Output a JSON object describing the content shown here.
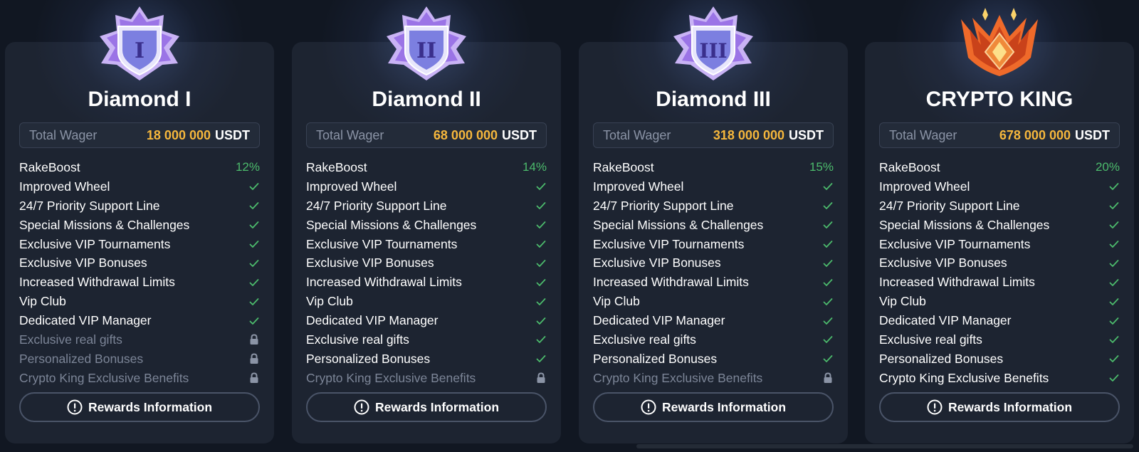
{
  "colors": {
    "background": "#111722",
    "card": "#1d2431",
    "wager_amount": "#f6b73c",
    "percent": "#4cbb6c",
    "check": "#4cbb6c",
    "locked_text": "#7c8597"
  },
  "tiers": [
    {
      "title": "Diamond I",
      "badge": "diamond-badge-roman-1",
      "badge_numeral": "I",
      "wager_label": "Total Wager",
      "wager_amount": "18 000 000",
      "wager_unit": "USDT",
      "rakeboost_label": "RakeBoost",
      "rakeboost_value": "12%",
      "benefits": [
        {
          "label": "Improved Wheel",
          "status": "check"
        },
        {
          "label": "24/7 Priority Support Line",
          "status": "check"
        },
        {
          "label": "Special Missions & Challenges",
          "status": "check"
        },
        {
          "label": "Exclusive VIP Tournaments",
          "status": "check"
        },
        {
          "label": "Exclusive VIP Bonuses",
          "status": "check"
        },
        {
          "label": "Increased Withdrawal Limits",
          "status": "check"
        },
        {
          "label": "Vip Club",
          "status": "check"
        },
        {
          "label": "Dedicated VIP Manager",
          "status": "check"
        },
        {
          "label": "Exclusive real gifts",
          "status": "lock"
        },
        {
          "label": "Personalized Bonuses",
          "status": "lock"
        },
        {
          "label": "Crypto King Exclusive Benefits",
          "status": "lock"
        }
      ],
      "button_label": "Rewards Information"
    },
    {
      "title": "Diamond II",
      "badge": "diamond-badge-roman-2",
      "badge_numeral": "II",
      "wager_label": "Total Wager",
      "wager_amount": "68 000 000",
      "wager_unit": "USDT",
      "rakeboost_label": "RakeBoost",
      "rakeboost_value": "14%",
      "benefits": [
        {
          "label": "Improved Wheel",
          "status": "check"
        },
        {
          "label": "24/7 Priority Support Line",
          "status": "check"
        },
        {
          "label": "Special Missions & Challenges",
          "status": "check"
        },
        {
          "label": "Exclusive VIP Tournaments",
          "status": "check"
        },
        {
          "label": "Exclusive VIP Bonuses",
          "status": "check"
        },
        {
          "label": "Increased Withdrawal Limits",
          "status": "check"
        },
        {
          "label": "Vip Club",
          "status": "check"
        },
        {
          "label": "Dedicated VIP Manager",
          "status": "check"
        },
        {
          "label": "Exclusive real gifts",
          "status": "check"
        },
        {
          "label": "Personalized Bonuses",
          "status": "check"
        },
        {
          "label": "Crypto King Exclusive Benefits",
          "status": "lock"
        }
      ],
      "button_label": "Rewards Information"
    },
    {
      "title": "Diamond III",
      "badge": "diamond-badge-roman-3",
      "badge_numeral": "III",
      "wager_label": "Total Wager",
      "wager_amount": "318 000 000",
      "wager_unit": "USDT",
      "rakeboost_label": "RakeBoost",
      "rakeboost_value": "15%",
      "benefits": [
        {
          "label": "Improved Wheel",
          "status": "check"
        },
        {
          "label": "24/7 Priority Support Line",
          "status": "check"
        },
        {
          "label": "Special Missions & Challenges",
          "status": "check"
        },
        {
          "label": "Exclusive VIP Tournaments",
          "status": "check"
        },
        {
          "label": "Exclusive VIP Bonuses",
          "status": "check"
        },
        {
          "label": "Increased Withdrawal Limits",
          "status": "check"
        },
        {
          "label": "Vip Club",
          "status": "check"
        },
        {
          "label": "Dedicated VIP Manager",
          "status": "check"
        },
        {
          "label": "Exclusive real gifts",
          "status": "check"
        },
        {
          "label": "Personalized Bonuses",
          "status": "check"
        },
        {
          "label": "Crypto King Exclusive Benefits",
          "status": "lock"
        }
      ],
      "button_label": "Rewards Information"
    },
    {
      "title": "CRYPTO KING",
      "badge": "crypto-king-crown-badge",
      "badge_numeral": "",
      "wager_label": "Total Wager",
      "wager_amount": "678 000 000",
      "wager_unit": "USDT",
      "rakeboost_label": "RakeBoost",
      "rakeboost_value": "20%",
      "benefits": [
        {
          "label": "Improved Wheel",
          "status": "check"
        },
        {
          "label": "24/7 Priority Support Line",
          "status": "check"
        },
        {
          "label": "Special Missions & Challenges",
          "status": "check"
        },
        {
          "label": "Exclusive VIP Tournaments",
          "status": "check"
        },
        {
          "label": "Exclusive VIP Bonuses",
          "status": "check"
        },
        {
          "label": "Increased Withdrawal Limits",
          "status": "check"
        },
        {
          "label": "Vip Club",
          "status": "check"
        },
        {
          "label": "Dedicated VIP Manager",
          "status": "check"
        },
        {
          "label": "Exclusive real gifts",
          "status": "check"
        },
        {
          "label": "Personalized Bonuses",
          "status": "check"
        },
        {
          "label": "Crypto King Exclusive Benefits",
          "status": "check"
        }
      ],
      "button_label": "Rewards Information"
    }
  ]
}
